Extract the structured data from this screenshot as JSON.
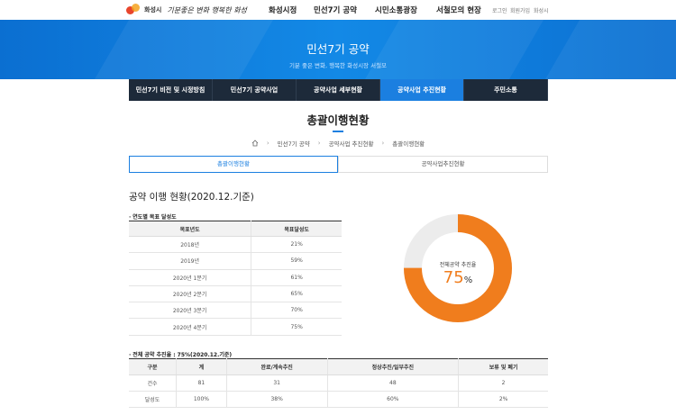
{
  "header": {
    "city_name": "화성시",
    "slogan": "기분좋은 변화 행복한 화성",
    "gnb": [
      "화성시정",
      "민선7기 공약",
      "시민소통광장",
      "서철모의 현장"
    ],
    "utility": [
      "로그인",
      "회원가입",
      "화성시"
    ]
  },
  "banner": {
    "title": "민선7기 공약",
    "subtitle": "기분 좋은 변화, 행복한 화성시장 서철모"
  },
  "subnav": {
    "items": [
      "민선7기 비전 및 시정방침",
      "민선7기 공약사업",
      "공약사업 세부현황",
      "공약사업 추진현황",
      "주민소통"
    ],
    "active_index": 3
  },
  "page": {
    "title": "총괄이행현황",
    "breadcrumb": [
      "민선7기 공약",
      "공약사업 추진현황",
      "총괄이행현황"
    ]
  },
  "tabs": [
    "총괄이행현황",
    "공약사업추진현황"
  ],
  "section": {
    "title": "공약 이행 현황(2020.12.기준)",
    "target_label": "연도별 목표 달성도",
    "progress_label": "전체 공약 추진율 : 75%(2020.12.기준)"
  },
  "target_table": {
    "headers": [
      "목표년도",
      "목표달성도"
    ],
    "rows": [
      [
        "2018년",
        "21%"
      ],
      [
        "2019년",
        "59%"
      ],
      [
        "2020년 1분기",
        "61%"
      ],
      [
        "2020년 2분기",
        "65%"
      ],
      [
        "2020년 3분기",
        "70%"
      ],
      [
        "2020년 4분기",
        "75%"
      ]
    ]
  },
  "donut": {
    "caption": "전체공약 추진율",
    "value": "75",
    "unit": "%",
    "fraction": 0.75,
    "color": "#f07d1d",
    "track_color": "#ececec"
  },
  "progress_table": {
    "headers": [
      "구분",
      "계",
      "완료/계속추진",
      "정상추진/일부추진",
      "보류 및 폐기"
    ],
    "rows": [
      [
        "건수",
        "81",
        "31",
        "48",
        "2"
      ],
      [
        "달성도",
        "100%",
        "38%",
        "60%",
        "2%"
      ]
    ]
  },
  "colors": {
    "accent": "#1b7fe0",
    "nav_dark": "#1d2a3a",
    "donut": "#f07d1d"
  }
}
